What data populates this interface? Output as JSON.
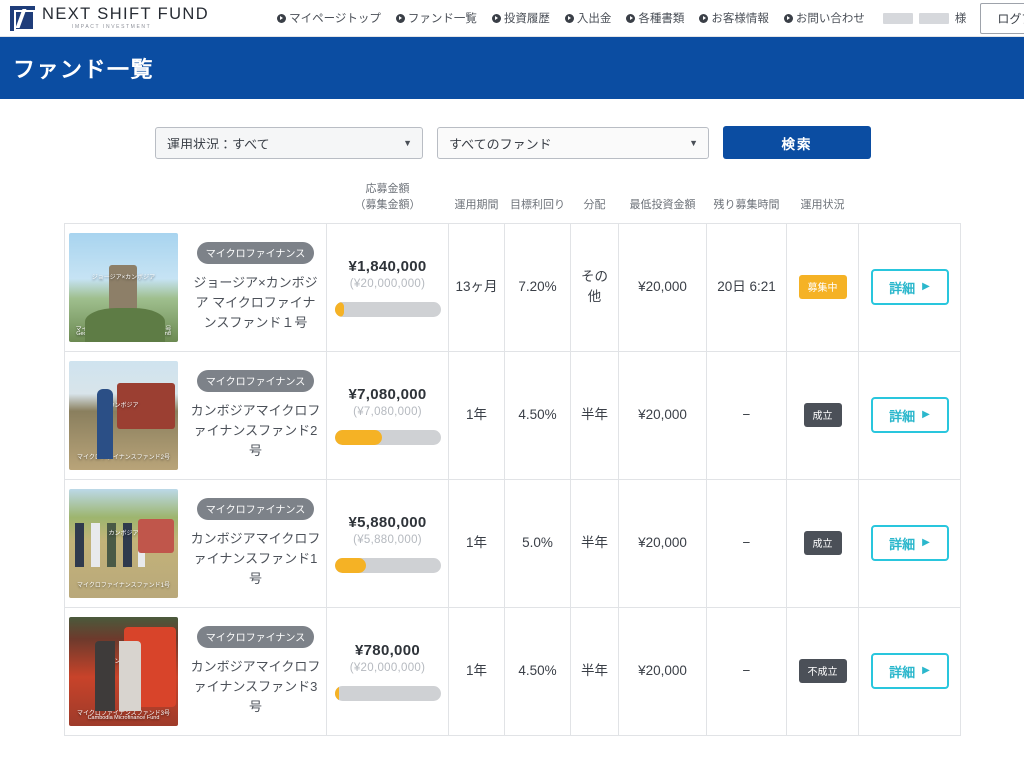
{
  "header": {
    "logo_text": "NEXT SHIFT FUND",
    "logo_sub": "IMPACT INVESTMENT",
    "nav": [
      {
        "label": "マイページトップ"
      },
      {
        "label": "ファンド一覧"
      },
      {
        "label": "投資履歴"
      },
      {
        "label": "入出金"
      },
      {
        "label": "各種書類"
      },
      {
        "label": "お客様情報"
      },
      {
        "label": "お問い合わせ"
      }
    ],
    "user_suffix": "様",
    "logout_label": "ログアウト"
  },
  "banner": {
    "title": "ファンド一覧"
  },
  "filters": {
    "status_select": {
      "value": "運用状況：すべて",
      "options": [
        "運用状況：すべて"
      ]
    },
    "fund_select": {
      "value": "すべてのファンド",
      "options": [
        "すべてのファンド"
      ]
    },
    "search_label": "検索",
    "arrow": "▼"
  },
  "table": {
    "headers": {
      "info": "",
      "amount_line1": "応募金額",
      "amount_line2": "（募集金額）",
      "period": "運用期間",
      "yield": "目標利回り",
      "distribution": "分配",
      "min_invest": "最低投資金額",
      "time_left": "残り募集時間",
      "status": "運用状況",
      "action": ""
    },
    "detail_label": "詳細",
    "detail_arrow": "▶",
    "rows": [
      {
        "category": "マイクロファイナンス",
        "name": "ジョージア×カンボジア マイクロファイナンスファンド１号",
        "thumb_caption_mid": "ジョージア×カンボジア",
        "thumb_caption_low": "マイクロファイナンスファンド１号",
        "thumb_caption_en": "Georgia×Cambodia Microfinance Fund",
        "amount": "¥1,840,000",
        "target": "(¥20,000,000)",
        "progress_pct": 9,
        "period": "13ヶ月",
        "yield": "7.20%",
        "distribution": "その他",
        "min_invest": "¥20,000",
        "time_left": "20日 6:21",
        "status": "募集中",
        "status_kind": "open"
      },
      {
        "category": "マイクロファイナンス",
        "name": "カンボジアマイクロファイナンスファンド2号",
        "thumb_caption_mid": "カンボジア",
        "thumb_caption_low": "マイクロファイナンスファンド2号",
        "thumb_caption_en": "",
        "amount": "¥7,080,000",
        "target": "(¥7,080,000)",
        "progress_pct": 45,
        "period": "1年",
        "yield": "4.50%",
        "distribution": "半年",
        "min_invest": "¥20,000",
        "time_left": "−",
        "status": "成立",
        "status_kind": "done"
      },
      {
        "category": "マイクロファイナンス",
        "name": "カンボジアマイクロファイナンスファンド1号",
        "thumb_caption_mid": "カンボジア",
        "thumb_caption_low": "マイクロファイナンスファンド1号",
        "thumb_caption_en": "",
        "amount": "¥5,880,000",
        "target": "(¥5,880,000)",
        "progress_pct": 30,
        "period": "1年",
        "yield": "5.0%",
        "distribution": "半年",
        "min_invest": "¥20,000",
        "time_left": "−",
        "status": "成立",
        "status_kind": "done"
      },
      {
        "category": "マイクロファイナンス",
        "name": "カンボジアマイクロファイナンスファンド3号",
        "thumb_caption_mid": "カンボジア",
        "thumb_caption_low": "マイクロファイナンスファンド3号",
        "thumb_caption_en": "Cambodia Microfinance Fund",
        "amount": "¥780,000",
        "target": "(¥20,000,000)",
        "progress_pct": 4,
        "period": "1年",
        "yield": "4.50%",
        "distribution": "半年",
        "min_invest": "¥20,000",
        "time_left": "−",
        "status": "不成立",
        "status_kind": "fail"
      }
    ]
  }
}
